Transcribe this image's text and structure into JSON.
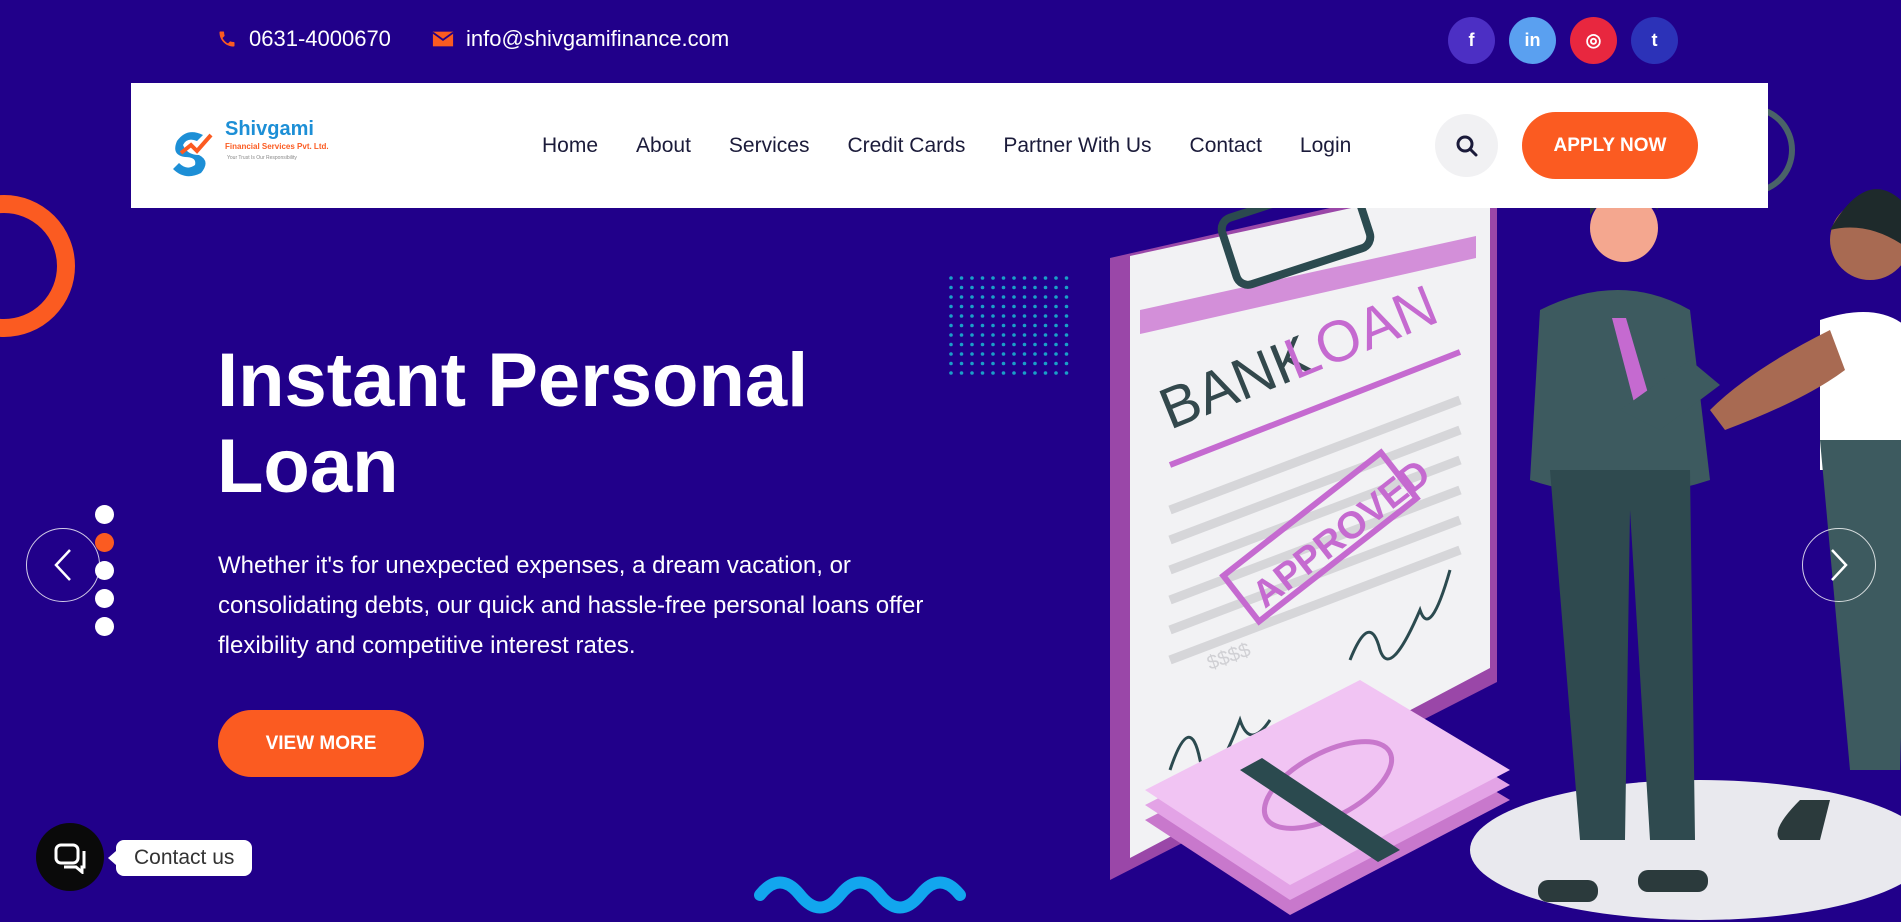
{
  "topbar": {
    "phone": "0631-4000670",
    "email": "info@shivgamifinance.com",
    "socials": [
      {
        "name": "facebook",
        "glyph": "f",
        "color": "#4c2fc4"
      },
      {
        "name": "linkedin",
        "glyph": "in",
        "color": "#5aa0f0"
      },
      {
        "name": "instagram",
        "glyph": "◎",
        "color": "#e8273f"
      },
      {
        "name": "twitter",
        "glyph": "t",
        "color": "#2c32b8"
      }
    ]
  },
  "brand": {
    "name": "Shivgami",
    "subtitle": "Financial Services Pvt. Ltd.",
    "tagline": "Your Trust Is Our Responsibility"
  },
  "nav": {
    "items": [
      "Home",
      "About",
      "Services",
      "Credit Cards",
      "Partner With Us",
      "Contact",
      "Login"
    ],
    "apply_label": "APPLY NOW"
  },
  "hero": {
    "title": "Instant Personal Loan",
    "description": "Whether it's for unexpected expenses, a dream vacation, or consolidating debts, our quick and hassle-free personal loans offer flexibility and competitive interest rates.",
    "cta_label": "VIEW MORE",
    "slide_count": 5,
    "active_slide": 2
  },
  "illustration": {
    "doc_word1": "BANK",
    "doc_word2": "LOAN",
    "stamp": "APPROVED",
    "money_mark": "$$$$"
  },
  "chat": {
    "label": "Contact us"
  },
  "colors": {
    "background": "#21008a",
    "accent": "#fb5b21",
    "navy_text": "#1b1b3a"
  }
}
